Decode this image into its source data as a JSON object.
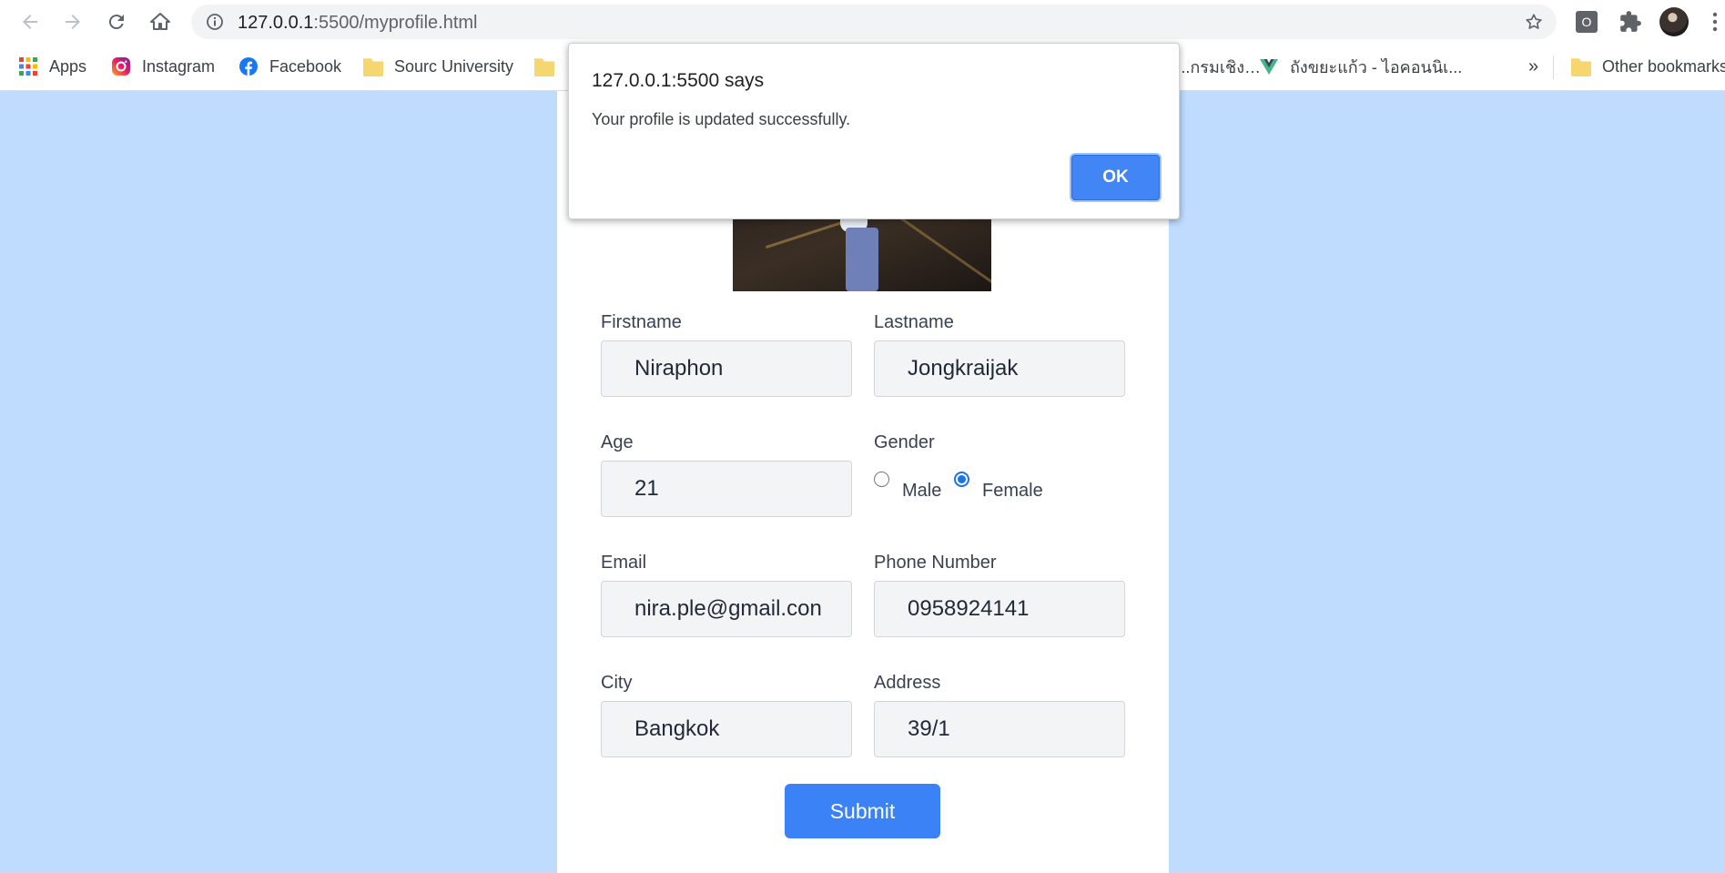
{
  "browser": {
    "url_host": "127.0.0.1",
    "url_path": ":5500/myprofile.html"
  },
  "bookmarks": [
    {
      "label": "Apps",
      "icon": "apps-grid-icon"
    },
    {
      "label": "Instagram",
      "icon": "instagram-icon"
    },
    {
      "label": "Facebook",
      "icon": "facebook-icon"
    },
    {
      "label": "Sourc University",
      "icon": "folder-icon"
    },
    {
      "label": "…กรมเชิง...",
      "icon": "folder-icon"
    },
    {
      "label": "ถังขยะแก้ว - ไอคอนนิเ...",
      "icon": "vue-icon"
    },
    {
      "label": "»",
      "icon": "overflow-icon"
    },
    {
      "label": "Other bookmarks",
      "icon": "folder-icon"
    }
  ],
  "form": {
    "firstname_label": "Firstname",
    "firstname_value": "Niraphon",
    "lastname_label": "Lastname",
    "lastname_value": "Jongkraijak",
    "age_label": "Age",
    "age_value": "21",
    "gender_label": "Gender",
    "gender_options": [
      "Male",
      "Female"
    ],
    "gender_selected": "Female",
    "email_label": "Email",
    "email_value": "nira.ple@gmail.con",
    "phone_label": "Phone Number",
    "phone_value": "0958924141",
    "city_label": "City",
    "city_value": "Bangkok",
    "address_label": "Address",
    "address_value": "39/1",
    "submit_label": "Submit"
  },
  "dialog": {
    "title": "127.0.0.1:5500 says",
    "message": "Your profile is updated successfully.",
    "ok_label": "OK"
  },
  "colors": {
    "page_background": "#bfdbfe",
    "submit_button": "#3b82f6",
    "ok_button": "#4285f4"
  }
}
